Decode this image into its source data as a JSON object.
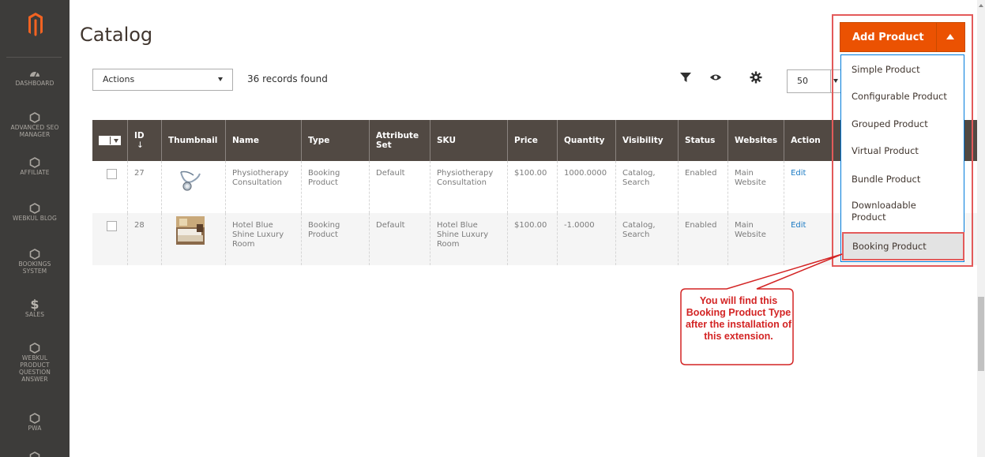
{
  "sidebar": {
    "items": [
      {
        "label": "DASHBOARD",
        "icon": "dashboard-icon"
      },
      {
        "label": "ADVANCED SEO MANAGER",
        "icon": "hexagon-icon"
      },
      {
        "label": "AFFILIATE",
        "icon": "hexagon-icon"
      },
      {
        "label": "WEBKUL BLOG",
        "icon": "hexagon-icon"
      },
      {
        "label": "BOOKINGS SYSTEM",
        "icon": "hexagon-icon"
      },
      {
        "label": "SALES",
        "icon": "dollar-icon"
      },
      {
        "label": "WEBKUL PRODUCT QUESTION ANSWER",
        "icon": "hexagon-icon"
      },
      {
        "label": "PWA",
        "icon": "hexagon-icon"
      }
    ],
    "dollar_glyph": "$"
  },
  "header": {
    "title": "Catalog"
  },
  "toolbar": {
    "actions_label": "Actions",
    "records_found": "36 records found",
    "per_page": "50"
  },
  "add_product": {
    "label": "Add Product",
    "menu": [
      "Simple Product",
      "Configurable Product",
      "Grouped Product",
      "Virtual Product",
      "Bundle Product",
      "Downloadable Product",
      "Booking Product"
    ]
  },
  "grid": {
    "columns": [
      "ID",
      "Thumbnail",
      "Name",
      "Type",
      "Attribute Set",
      "SKU",
      "Price",
      "Quantity",
      "Visibility",
      "Status",
      "Websites",
      "Action"
    ],
    "sort_indicator": "↓",
    "rows": [
      {
        "id": "27",
        "name": "Physiotherapy Consultation",
        "type": "Booking Product",
        "attribute_set": "Default",
        "sku": "Physiotherapy Consultation",
        "price": "$100.00",
        "quantity": "1000.0000",
        "visibility": "Catalog, Search",
        "status": "Enabled",
        "websites": "Main Website",
        "action": "Edit",
        "thumbnail": "stethoscope-image"
      },
      {
        "id": "28",
        "name": "Hotel Blue Shine Luxury Room",
        "type": "Booking Product",
        "attribute_set": "Default",
        "sku": "Hotel Blue Shine Luxury Room",
        "price": "$100.00",
        "quantity": "-1.0000",
        "visibility": "Catalog, Search",
        "status": "Enabled",
        "websites": "Main Website",
        "action": "Edit",
        "thumbnail": "hotel-room-image"
      }
    ]
  },
  "callout": {
    "text": "You will find this Booking Product Type after the installation of this extension.",
    "color": "#d32424"
  },
  "colors": {
    "accent": "#eb5202",
    "sidebar": "#3d3c3a",
    "table_header": "#514943",
    "link": "#1979c3"
  }
}
